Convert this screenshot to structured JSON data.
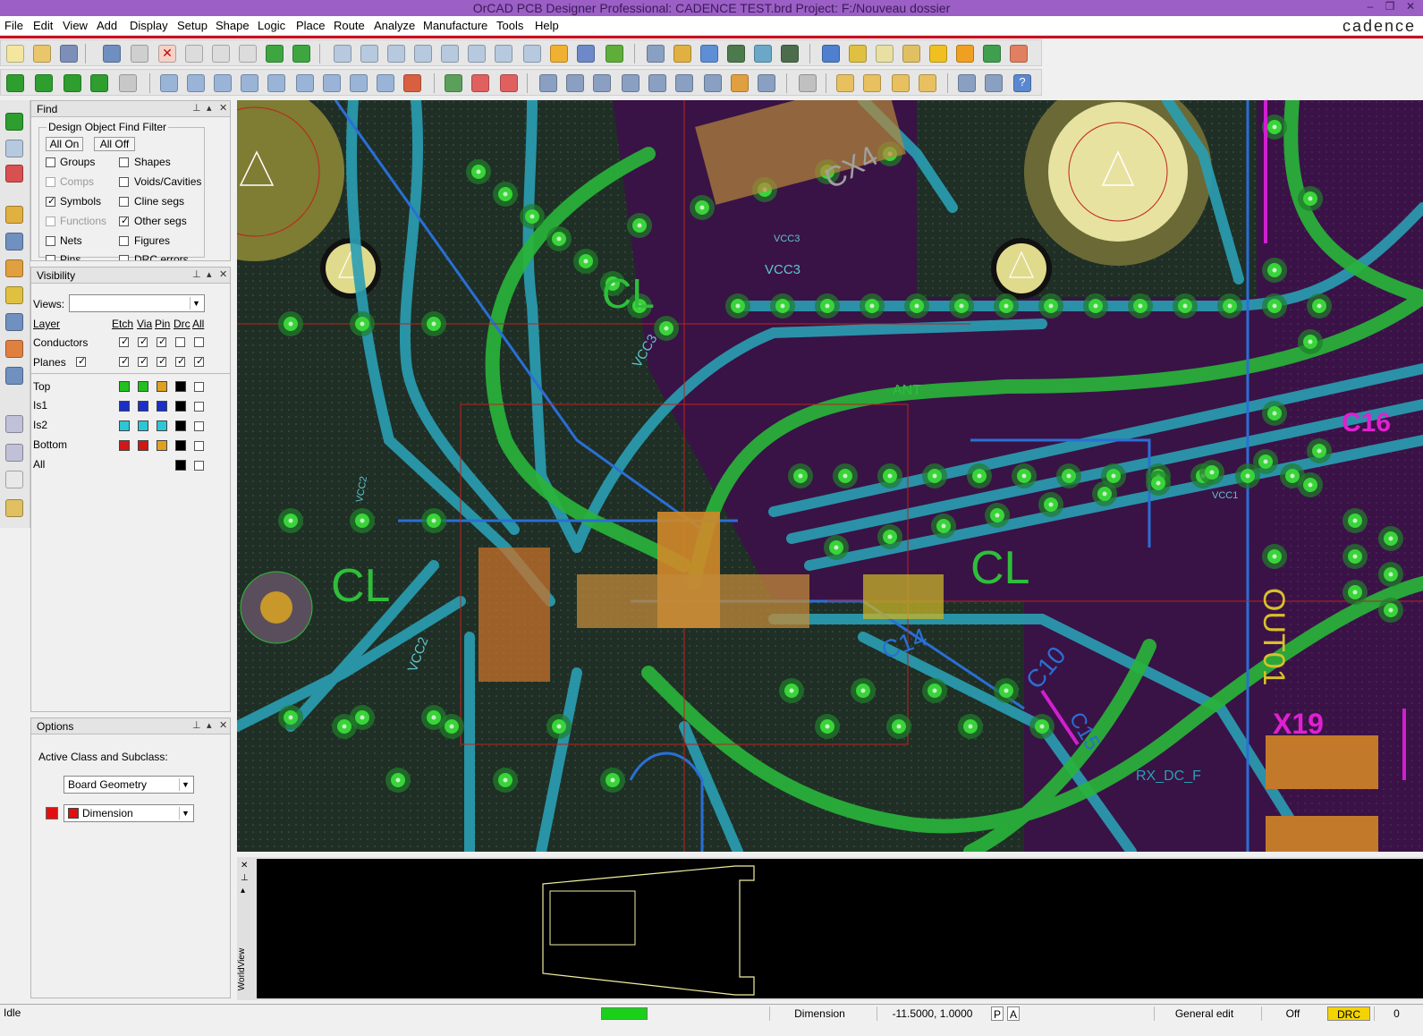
{
  "window": {
    "title": "OrCAD PCB Designer Professional: CADENCE TEST.brd  Project: F:/Nouveau dossier",
    "controls": [
      "–",
      "❐",
      "✕"
    ]
  },
  "brand": "cadence",
  "menu": [
    "File",
    "Edit",
    "View",
    "Add",
    "Display",
    "Setup",
    "Shape",
    "Logic",
    "Place",
    "Route",
    "Analyze",
    "Manufacture",
    "Tools",
    "Help"
  ],
  "find": {
    "title": "Find",
    "group_title": "Design Object Find Filter",
    "all_on": "All On",
    "all_off": "All Off",
    "items": [
      {
        "label": "Groups",
        "checked": false,
        "enabled": true
      },
      {
        "label": "Shapes",
        "checked": false,
        "enabled": true
      },
      {
        "label": "Comps",
        "checked": false,
        "enabled": false
      },
      {
        "label": "Voids/Cavities",
        "checked": false,
        "enabled": true
      },
      {
        "label": "Symbols",
        "checked": true,
        "enabled": true
      },
      {
        "label": "Cline segs",
        "checked": false,
        "enabled": true
      },
      {
        "label": "Functions",
        "checked": false,
        "enabled": false
      },
      {
        "label": "Other segs",
        "checked": true,
        "enabled": true
      },
      {
        "label": "Nets",
        "checked": false,
        "enabled": true
      },
      {
        "label": "Figures",
        "checked": false,
        "enabled": true
      },
      {
        "label": "Pins",
        "checked": false,
        "enabled": true
      },
      {
        "label": "DRC errors",
        "checked": false,
        "enabled": true
      }
    ]
  },
  "visibility": {
    "title": "Visibility",
    "views_label": "Views:",
    "views_value": "",
    "headers": [
      "Layer",
      "Etch",
      "Via",
      "Pin",
      "Drc",
      "All"
    ],
    "rows": [
      {
        "label": "Conductors"
      },
      {
        "label": "Planes"
      }
    ],
    "layers": [
      {
        "label": "Top",
        "colors": [
          "#22c21e",
          "#22c21e",
          "#e0a020",
          "#000000"
        ]
      },
      {
        "label": "Is1",
        "colors": [
          "#1a2fc8",
          "#1a2fc8",
          "#1a2fc8",
          "#000000"
        ]
      },
      {
        "label": "Is2",
        "colors": [
          "#2bc7d6",
          "#2bc7d6",
          "#2bc7d6",
          "#000000"
        ]
      },
      {
        "label": "Bottom",
        "colors": [
          "#d01818",
          "#d01818",
          "#e0a020",
          "#000000"
        ]
      },
      {
        "label": "All",
        "colors": [
          "#000000"
        ]
      }
    ]
  },
  "options": {
    "title": "Options",
    "active_label": "Active Class and Subclass:",
    "class_value": "Board Geometry",
    "subclass_value": "Dimension",
    "subclass_color": "#e01010"
  },
  "canvas_labels": [
    "CL",
    "CL",
    "CL",
    "VCC3",
    "VCC3",
    "VCC2",
    "ANT",
    "CX4",
    "C16",
    "C10",
    "C14",
    "C15",
    "OUT01",
    "X19",
    "RX_DC_F",
    "VCC1",
    "VCC3",
    "VCC2"
  ],
  "worldview": {
    "label": "WorldView"
  },
  "status": {
    "mode": "Idle",
    "subclass": "Dimension",
    "coords": "-11.5000, 1.0000",
    "p": "P",
    "a": "A",
    "edit_mode": "General edit",
    "off": "Off",
    "drc": "DRC",
    "drc_count": "0"
  },
  "colors": {
    "titlebar": "#9b5fc6",
    "accent_red": "#c80f1e",
    "board_bg": "#1f2f25",
    "plane_purple": "#3b1247",
    "trace_green": "#29b33a",
    "trace_cyan": "#2a9fb3",
    "via_green": "#39d439"
  }
}
